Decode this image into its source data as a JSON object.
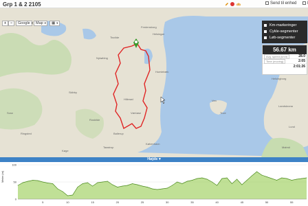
{
  "header": {
    "title": "Grp 1 & 2 2105",
    "send_label": "Send til enhed",
    "send2_label": "Do"
  },
  "map": {
    "zoom_in": "+",
    "zoom_out": "−",
    "provider": "Google",
    "maptype": "Map",
    "layers_label": "▦",
    "labels": [
      "Nykøbing",
      "Tisvilde",
      "Helsingør",
      "Humlebæk",
      "Fredensborg",
      "Hillerød",
      "Skibby",
      "Roskilde",
      "Værløse",
      "Ballerup",
      "København",
      "Taastrup",
      "Køge",
      "Malmö",
      "Lund",
      "Landskrona",
      "Helsingborg",
      "Tuve",
      "Ven",
      "Ringsted",
      "Sorø"
    ]
  },
  "legend": {
    "items": [
      "Km-markeringer",
      "Cykle-segmenter",
      "Løb-segmenter"
    ]
  },
  "stats": {
    "distance": "56.67 km",
    "row1_label": "Avg. speed (km/t)",
    "row1_value": "28.0",
    "row2_label": "Time (moving)",
    "row2_value": "2:05",
    "row3_value": "2:01:26"
  },
  "elevation": {
    "bar_label": "Højde ▾",
    "ylabel": "Meter (m)",
    "y_ticks": [
      "100",
      "50",
      "0"
    ],
    "x_ticks": [
      "5",
      "10",
      "15",
      "20",
      "25",
      "30",
      "35",
      "40",
      "45",
      "50",
      "55"
    ],
    "color": "#8cc63f"
  },
  "colors": {
    "route": "#e02424",
    "water": "#a9c8e8",
    "land": "#e6e2d4",
    "green": "#c7dcb0",
    "ui_dark": "#2a2a2a",
    "ui_blue": "#3d82c6"
  },
  "chart_data": {
    "type": "area",
    "xlabel": "",
    "ylabel": "Meter (m)",
    "xlim": [
      0,
      58
    ],
    "ylim": [
      0,
      100
    ],
    "x": [
      0,
      1,
      2,
      3,
      4,
      5,
      6,
      7,
      8,
      9,
      10,
      11,
      12,
      13,
      14,
      15,
      16,
      17,
      18,
      19,
      20,
      21,
      22,
      23,
      24,
      25,
      26,
      27,
      28,
      29,
      30,
      31,
      32,
      33,
      34,
      35,
      36,
      37,
      38,
      39,
      40,
      41,
      42,
      43,
      44,
      45,
      46,
      47,
      48,
      49,
      50,
      51,
      52,
      53,
      54,
      55,
      56,
      57,
      58
    ],
    "series": [
      {
        "values": [
          40,
          48,
          52,
          55,
          54,
          50,
          47,
          45,
          30,
          22,
          10,
          12,
          35,
          45,
          48,
          38,
          48,
          50,
          52,
          42,
          35,
          38,
          40,
          45,
          42,
          38,
          35,
          30,
          28,
          30,
          32,
          40,
          50,
          45,
          52,
          55,
          60,
          62,
          58,
          50,
          40,
          60,
          62,
          45,
          58,
          42,
          55,
          68,
          80,
          70,
          65,
          60,
          55,
          62,
          60,
          55,
          58,
          60,
          62
        ]
      }
    ]
  }
}
